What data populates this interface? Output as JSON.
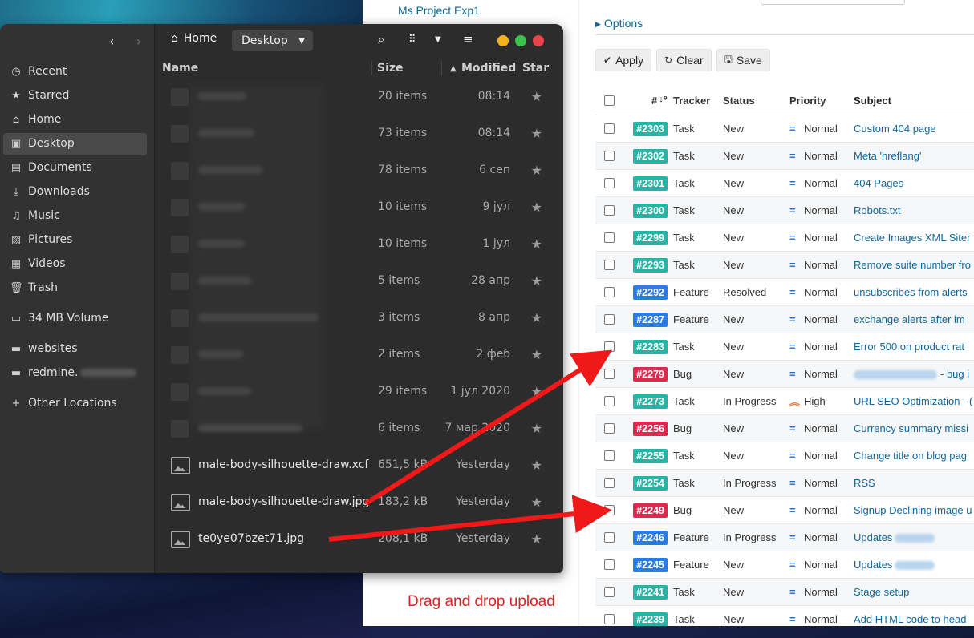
{
  "desktop": {
    "caption": "Drag and drop upload"
  },
  "redmine": {
    "sidebar": {
      "project": "Ms Project Exp1"
    },
    "options_label": "Options",
    "buttons": {
      "apply": "Apply",
      "clear": "Clear",
      "save": "Save"
    },
    "columns": {
      "id": "#",
      "tracker": "Tracker",
      "status": "Status",
      "priority": "Priority",
      "subject": "Subject"
    },
    "colors": {
      "task": "#26b5a5",
      "feature": "#2a7be4",
      "bug": "#e0284f"
    },
    "issues": [
      {
        "id": "#2303",
        "tracker": "Task",
        "status": "New",
        "priority": "Normal",
        "subject": "Custom 404 page"
      },
      {
        "id": "#2302",
        "tracker": "Task",
        "status": "New",
        "priority": "Normal",
        "subject": "Meta 'hreflang'"
      },
      {
        "id": "#2301",
        "tracker": "Task",
        "status": "New",
        "priority": "Normal",
        "subject": "404 Pages"
      },
      {
        "id": "#2300",
        "tracker": "Task",
        "status": "New",
        "priority": "Normal",
        "subject": "Robots.txt"
      },
      {
        "id": "#2299",
        "tracker": "Task",
        "status": "New",
        "priority": "Normal",
        "subject": "Create Images XML Siter"
      },
      {
        "id": "#2293",
        "tracker": "Task",
        "status": "New",
        "priority": "Normal",
        "subject": "Remove suite number fro"
      },
      {
        "id": "#2292",
        "tracker": "Feature",
        "status": "Resolved",
        "priority": "Normal",
        "subject": "unsubscribes from alerts"
      },
      {
        "id": "#2287",
        "tracker": "Feature",
        "status": "New",
        "priority": "Normal",
        "subject": "exchange alerts after im"
      },
      {
        "id": "#2283",
        "tracker": "Task",
        "status": "New",
        "priority": "Normal",
        "subject": "Error 500 on product rat"
      },
      {
        "id": "#2279",
        "tracker": "Bug",
        "status": "New",
        "priority": "Normal",
        "subject": "- bug i"
      },
      {
        "id": "#2273",
        "tracker": "Task",
        "status": "In Progress",
        "priority": "High",
        "subject": "URL SEO Optimization - ("
      },
      {
        "id": "#2256",
        "tracker": "Bug",
        "status": "New",
        "priority": "Normal",
        "subject": "Currency summary missi"
      },
      {
        "id": "#2255",
        "tracker": "Task",
        "status": "New",
        "priority": "Normal",
        "subject": "Change title on blog pag"
      },
      {
        "id": "#2254",
        "tracker": "Task",
        "status": "In Progress",
        "priority": "Normal",
        "subject": "RSS"
      },
      {
        "id": "#2249",
        "tracker": "Bug",
        "status": "New",
        "priority": "Normal",
        "subject": "Signup Declining image u"
      },
      {
        "id": "#2246",
        "tracker": "Feature",
        "status": "In Progress",
        "priority": "Normal",
        "subject": "Updates"
      },
      {
        "id": "#2245",
        "tracker": "Feature",
        "status": "New",
        "priority": "Normal",
        "subject": "Updates"
      },
      {
        "id": "#2241",
        "tracker": "Task",
        "status": "New",
        "priority": "Normal",
        "subject": "Stage setup"
      },
      {
        "id": "#2239",
        "tracker": "Task",
        "status": "New",
        "priority": "Normal",
        "subject": "Add HTML code to head"
      }
    ]
  },
  "filemanager": {
    "nav": {
      "home": "Home",
      "current": "Desktop"
    },
    "sidebar": {
      "recent": "Recent",
      "starred": "Starred",
      "home": "Home",
      "desktop": "Desktop",
      "documents": "Documents",
      "downloads": "Downloads",
      "music": "Music",
      "pictures": "Pictures",
      "videos": "Videos",
      "trash": "Trash",
      "volume": "34 MB Volume",
      "websites": "websites",
      "redmine": "redmine.",
      "other": "Other Locations"
    },
    "columns": {
      "name": "Name",
      "size": "Size",
      "modified": "Modified",
      "star": "Star"
    },
    "files": [
      {
        "name": "",
        "size": "20 items",
        "modified": "08:14"
      },
      {
        "name": "",
        "size": "73 items",
        "modified": "08:14"
      },
      {
        "name": "",
        "size": "78 items",
        "modified": "6 сеп"
      },
      {
        "name": "",
        "size": "10 items",
        "modified": "9 јул"
      },
      {
        "name": "",
        "size": "10 items",
        "modified": "1 јул"
      },
      {
        "name": "",
        "size": "5 items",
        "modified": "28 апр"
      },
      {
        "name": "",
        "size": "3 items",
        "modified": "8 апр"
      },
      {
        "name": "",
        "size": "2 items",
        "modified": "2 феб"
      },
      {
        "name": "",
        "size": "29 items",
        "modified": "1 јул 2020"
      },
      {
        "name": "",
        "size": "6 items",
        "modified": "7 мар 2020"
      },
      {
        "name": "male-body-silhouette-draw.xcf",
        "size": "651,5 kB",
        "modified": "Yesterday"
      },
      {
        "name": "male-body-silhouette-draw.jpg",
        "size": "183,2 kB",
        "modified": "Yesterday"
      },
      {
        "name": "te0ye07bzet71.jpg",
        "size": "208,1 kB",
        "modified": "Yesterday"
      }
    ]
  }
}
